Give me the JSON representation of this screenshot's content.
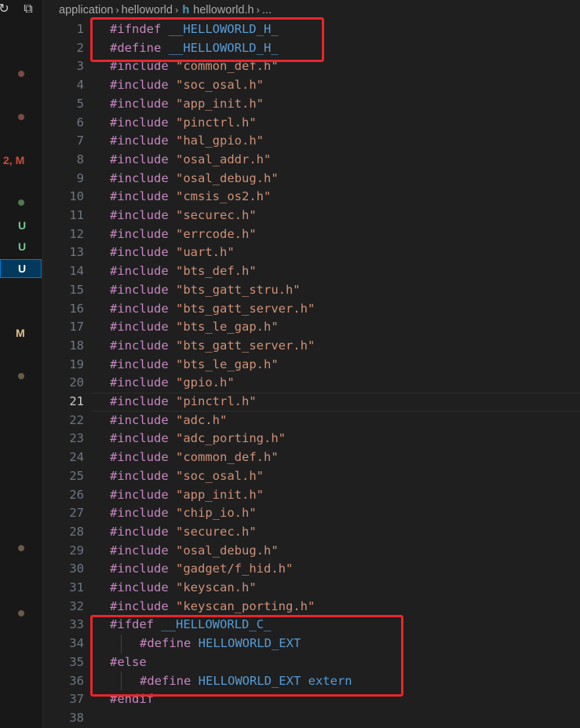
{
  "breadcrumb": {
    "parts": [
      "application",
      "helloworld",
      "helloworld.h",
      "..."
    ],
    "file_icon": "h"
  },
  "sidebar": {
    "icons": [
      "refresh-icon",
      "collapse-all-icon"
    ],
    "badges": [
      {
        "text": "2, M",
        "color": "#c74e39"
      },
      {
        "text": "U",
        "color": "#73c991"
      },
      {
        "text": "U",
        "color": "#73c991"
      },
      {
        "text": "U",
        "color": "#ffffff"
      },
      {
        "text": "M",
        "color": "#e2c08d"
      }
    ]
  },
  "editor": {
    "active_line": 21,
    "lines": [
      {
        "n": "1",
        "parts": [
          [
            "kw",
            "#ifndef "
          ],
          [
            "mac",
            "__HELLOWORLD_H_"
          ]
        ]
      },
      {
        "n": "2",
        "parts": [
          [
            "kw",
            "#define "
          ],
          [
            "mac",
            "__HELLOWORLD_H_"
          ]
        ]
      },
      {
        "n": "3",
        "parts": [
          [
            "kw",
            "#include "
          ],
          [
            "str",
            "\"common_def.h\""
          ]
        ]
      },
      {
        "n": "4",
        "parts": [
          [
            "kw",
            "#include "
          ],
          [
            "str",
            "\"soc_osal.h\""
          ]
        ]
      },
      {
        "n": "5",
        "parts": [
          [
            "kw",
            "#include "
          ],
          [
            "str",
            "\"app_init.h\""
          ]
        ]
      },
      {
        "n": "6",
        "parts": [
          [
            "kw",
            "#include "
          ],
          [
            "str",
            "\"pinctrl.h\""
          ]
        ]
      },
      {
        "n": "7",
        "parts": [
          [
            "kw",
            "#include "
          ],
          [
            "str",
            "\"hal_gpio.h\""
          ]
        ]
      },
      {
        "n": "8",
        "parts": [
          [
            "kw",
            "#include "
          ],
          [
            "str",
            "\"osal_addr.h\""
          ]
        ]
      },
      {
        "n": "9",
        "parts": [
          [
            "kw",
            "#include "
          ],
          [
            "str",
            "\"osal_debug.h\""
          ]
        ]
      },
      {
        "n": "10",
        "parts": [
          [
            "kw",
            "#include "
          ],
          [
            "str",
            "\"cmsis_os2.h\""
          ]
        ]
      },
      {
        "n": "11",
        "parts": [
          [
            "kw",
            "#include "
          ],
          [
            "str",
            "\"securec.h\""
          ]
        ]
      },
      {
        "n": "12",
        "parts": [
          [
            "kw",
            "#include "
          ],
          [
            "str",
            "\"errcode.h\""
          ]
        ]
      },
      {
        "n": "13",
        "parts": [
          [
            "kw",
            "#include "
          ],
          [
            "str",
            "\"uart.h\""
          ]
        ]
      },
      {
        "n": "14",
        "parts": [
          [
            "kw",
            "#include "
          ],
          [
            "str",
            "\"bts_def.h\""
          ]
        ]
      },
      {
        "n": "15",
        "parts": [
          [
            "kw",
            "#include "
          ],
          [
            "str",
            "\"bts_gatt_stru.h\""
          ]
        ]
      },
      {
        "n": "16",
        "parts": [
          [
            "kw",
            "#include "
          ],
          [
            "str",
            "\"bts_gatt_server.h\""
          ]
        ]
      },
      {
        "n": "17",
        "parts": [
          [
            "kw",
            "#include "
          ],
          [
            "str",
            "\"bts_le_gap.h\""
          ]
        ]
      },
      {
        "n": "18",
        "parts": [
          [
            "kw",
            "#include "
          ],
          [
            "str",
            "\"bts_gatt_server.h\""
          ]
        ]
      },
      {
        "n": "19",
        "parts": [
          [
            "kw",
            "#include "
          ],
          [
            "str",
            "\"bts_le_gap.h\""
          ]
        ]
      },
      {
        "n": "20",
        "parts": [
          [
            "kw",
            "#include "
          ],
          [
            "str",
            "\"gpio.h\""
          ]
        ]
      },
      {
        "n": "21",
        "parts": [
          [
            "kw",
            "#include "
          ],
          [
            "str",
            "\"pinctrl.h\""
          ]
        ]
      },
      {
        "n": "22",
        "parts": [
          [
            "kw",
            "#include "
          ],
          [
            "str",
            "\"adc.h\""
          ]
        ]
      },
      {
        "n": "23",
        "parts": [
          [
            "kw",
            "#include "
          ],
          [
            "str",
            "\"adc_porting.h\""
          ]
        ]
      },
      {
        "n": "24",
        "parts": [
          [
            "kw",
            "#include "
          ],
          [
            "str",
            "\"common_def.h\""
          ]
        ]
      },
      {
        "n": "25",
        "parts": [
          [
            "kw",
            "#include "
          ],
          [
            "str",
            "\"soc_osal.h\""
          ]
        ]
      },
      {
        "n": "26",
        "parts": [
          [
            "kw",
            "#include "
          ],
          [
            "str",
            "\"app_init.h\""
          ]
        ]
      },
      {
        "n": "27",
        "parts": [
          [
            "kw",
            "#include "
          ],
          [
            "str",
            "\"chip_io.h\""
          ]
        ]
      },
      {
        "n": "28",
        "parts": [
          [
            "kw",
            "#include "
          ],
          [
            "str",
            "\"securec.h\""
          ]
        ]
      },
      {
        "n": "29",
        "parts": [
          [
            "kw",
            "#include "
          ],
          [
            "str",
            "\"osal_debug.h\""
          ]
        ]
      },
      {
        "n": "30",
        "parts": [
          [
            "kw",
            "#include "
          ],
          [
            "str",
            "\"gadget/f_hid.h\""
          ]
        ]
      },
      {
        "n": "31",
        "parts": [
          [
            "kw",
            "#include "
          ],
          [
            "str",
            "\"keyscan.h\""
          ]
        ]
      },
      {
        "n": "32",
        "parts": [
          [
            "kw",
            "#include "
          ],
          [
            "str",
            "\"keyscan_porting.h\""
          ]
        ]
      },
      {
        "n": "33",
        "parts": [
          [
            "kw",
            "#ifdef "
          ],
          [
            "mac",
            "__HELLOWORLD_C_"
          ]
        ]
      },
      {
        "n": "34",
        "indent": true,
        "parts": [
          [
            "kw",
            "#define "
          ],
          [
            "mac",
            "HELLOWORLD_EXT"
          ]
        ]
      },
      {
        "n": "35",
        "parts": [
          [
            "kw",
            "#else"
          ]
        ]
      },
      {
        "n": "36",
        "indent": true,
        "parts": [
          [
            "kw",
            "#define "
          ],
          [
            "mac",
            "HELLOWORLD_EXT extern"
          ]
        ]
      },
      {
        "n": "37",
        "parts": [
          [
            "kw",
            "#endif"
          ]
        ]
      },
      {
        "n": "38",
        "parts": []
      }
    ]
  }
}
